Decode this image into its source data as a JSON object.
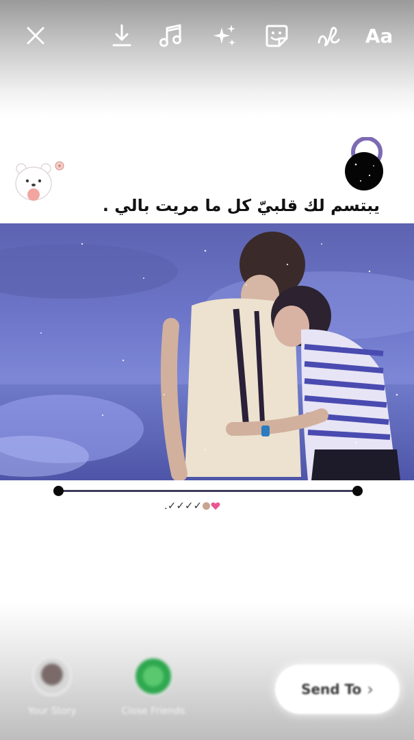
{
  "toolbar": {
    "icons": [
      "close-icon",
      "download-icon",
      "music-note-icon",
      "sparkles-effects-icon",
      "sticker-icon",
      "draw-scribble-icon"
    ],
    "text_tool_label": "Aa",
    "icon_color": "#ffffff"
  },
  "story": {
    "caption": "يبتسم لك قلبيّ كل ما مريت بالي .",
    "emoji_line": ".✓✓✓✓",
    "stickers": [
      "bear-sticker",
      "moon-sticker"
    ],
    "photo_tint": "#6c75c8"
  },
  "bottom_bar": {
    "your_story_label": "Your Story",
    "close_friends_label": "Close Friends",
    "close_friends_color": "#2fa84f",
    "send_to_label": "Send To",
    "send_chevron": "›"
  }
}
